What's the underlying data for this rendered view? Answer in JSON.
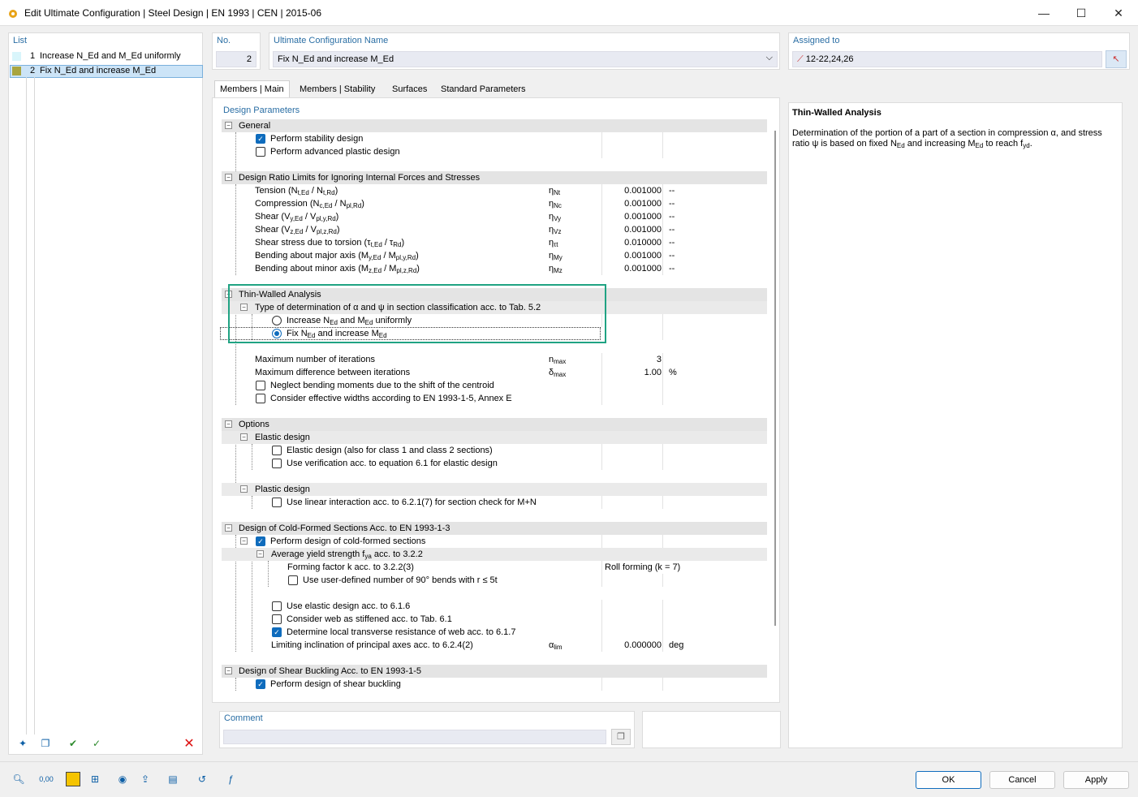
{
  "window": {
    "title": "Edit Ultimate Configuration | Steel Design | EN 1993 | CEN | 2015-06"
  },
  "list": {
    "header": "List",
    "items": [
      {
        "num": "1",
        "label": "Increase N_Ed and M_Ed uniformly",
        "color": "#d9f5fb"
      },
      {
        "num": "2",
        "label": "Fix N_Ed and increase M_Ed",
        "color": "#a9a540"
      }
    ]
  },
  "no": {
    "header": "No.",
    "value": "2"
  },
  "config_name": {
    "header": "Ultimate Configuration Name",
    "value": "Fix N_Ed and increase M_Ed"
  },
  "assigned": {
    "header": "Assigned to",
    "value": "12-22,24,26"
  },
  "tabs": [
    "Members | Main",
    "Members | Stability",
    "Surfaces",
    "Standard Parameters"
  ],
  "design_params_header": "Design Parameters",
  "general": {
    "title": "General",
    "perform_stability": "Perform stability design",
    "advanced_plastic": "Perform advanced plastic design"
  },
  "ratio": {
    "title": "Design Ratio Limits for Ignoring Internal Forces and Stresses",
    "rows": [
      {
        "label": "Tension (N",
        "sub1": "t,Ed",
        "mid": " / N",
        "sub2": "t,Rd",
        "end": ")",
        "sym": "η",
        "symsub": "Nt",
        "value": "0.001000",
        "unit": "--"
      },
      {
        "label": "Compression (N",
        "sub1": "c,Ed",
        "mid": " / N",
        "sub2": "pl,Rd",
        "end": ")",
        "sym": "η",
        "symsub": "Nc",
        "value": "0.001000",
        "unit": "--"
      },
      {
        "label": "Shear (V",
        "sub1": "y,Ed",
        "mid": " / V",
        "sub2": "pl,y,Rd",
        "end": ")",
        "sym": "η",
        "symsub": "Vy",
        "value": "0.001000",
        "unit": "--"
      },
      {
        "label": "Shear (V",
        "sub1": "z,Ed",
        "mid": " / V",
        "sub2": "pl,z,Rd",
        "end": ")",
        "sym": "η",
        "symsub": "Vz",
        "value": "0.001000",
        "unit": "--"
      },
      {
        "label": "Shear stress due to torsion (τ",
        "sub1": "t,Ed",
        "mid": " / τ",
        "sub2": "Rd",
        "end": ")",
        "sym": "η",
        "symsub": "τt",
        "value": "0.010000",
        "unit": "--"
      },
      {
        "label": "Bending about major axis (M",
        "sub1": "y,Ed",
        "mid": " / M",
        "sub2": "pl,y,Rd",
        "end": ")",
        "sym": "η",
        "symsub": "My",
        "value": "0.001000",
        "unit": "--"
      },
      {
        "label": "Bending about minor axis (M",
        "sub1": "z,Ed",
        "mid": " / M",
        "sub2": "pl,z,Rd",
        "end": ")",
        "sym": "η",
        "symsub": "Mz",
        "value": "0.001000",
        "unit": "--"
      }
    ]
  },
  "thin": {
    "title": "Thin-Walled Analysis",
    "type_label": "Type of determination of α and ψ in section classification acc. to Tab. 5.2",
    "opt1": "Increase N",
    "opt1_sub": "Ed",
    "opt1_mid": " and M",
    "opt1_sub2": "Ed",
    "opt1_end": " uniformly",
    "opt2": "Fix N",
    "opt2_sub": "Ed",
    "opt2_mid": " and increase M",
    "opt2_sub2": "Ed",
    "max_iter": "Maximum number of iterations",
    "max_iter_sym": "n",
    "max_iter_symsub": "max",
    "max_iter_val": "3",
    "max_diff": "Maximum difference between iterations",
    "max_diff_sym": "δ",
    "max_diff_symsub": "max",
    "max_diff_val": "1.00",
    "max_diff_unit": "%",
    "neglect": "Neglect bending moments due to the shift of the centroid",
    "eff_widths": "Consider effective widths according to EN 1993-1-5, Annex E"
  },
  "options": {
    "title": "Options",
    "elastic": "Elastic design",
    "elastic1": "Elastic design (also for class 1 and class 2 sections)",
    "elastic2": "Use verification acc. to equation 6.1 for elastic design",
    "plastic": "Plastic design",
    "plastic1": "Use linear interaction acc. to 6.2.1(7) for section check for M+N"
  },
  "cold": {
    "title": "Design of Cold-Formed Sections Acc. to EN 1993-1-3",
    "perform": "Perform design of cold-formed sections",
    "avg": "Average yield strength f",
    "avg_sub": "ya",
    "avg_end": " acc. to 3.2.2",
    "forming": "Forming factor k acc. to 3.2.2(3)",
    "forming_val": "Roll forming (k = 7)",
    "bends": "Use user-defined number of 90° bends with r ≤ 5t",
    "elastic": "Use elastic design acc. to 6.1.6",
    "web": "Consider web as stiffened acc. to Tab. 6.1",
    "local": "Determine local transverse resistance of web acc. to 6.1.7",
    "incl": "Limiting inclination of principal axes acc. to 6.2.4(2)",
    "incl_sym": "α",
    "incl_symsub": "lim",
    "incl_val": "0.000000",
    "incl_unit": "deg"
  },
  "shear": {
    "title": "Design of Shear Buckling Acc. to EN 1993-1-5",
    "perform": "Perform design of shear buckling"
  },
  "info": {
    "title": "Thin-Walled Analysis",
    "text1": "Determination of the portion of a part of a section in compression α, and stress ratio ψ is based on fixed N",
    "sub1": "Ed",
    "text2": " and increasing M",
    "sub2": "Ed",
    "text3": " to reach f",
    "sub3": "yd",
    "text4": "."
  },
  "comment": {
    "header": "Comment",
    "value": ""
  },
  "buttons": {
    "ok": "OK",
    "cancel": "Cancel",
    "apply": "Apply"
  },
  "colors": {
    "highlight": "#20a383",
    "accent": "#0f6cbd",
    "header": "#2a6ea4"
  }
}
